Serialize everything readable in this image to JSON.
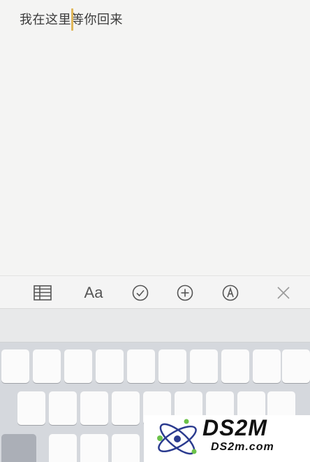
{
  "note": {
    "text": "我在这里等你回来"
  },
  "toolbar": {
    "items": [
      {
        "name": "table",
        "icon": "table-icon"
      },
      {
        "name": "format",
        "icon": "text-format-icon",
        "label": "Aa"
      },
      {
        "name": "checklist",
        "icon": "checklist-icon"
      },
      {
        "name": "add",
        "icon": "plus-circle-icon"
      },
      {
        "name": "markup",
        "icon": "markup-pen-icon"
      },
      {
        "name": "close",
        "icon": "close-icon"
      }
    ]
  },
  "colors": {
    "caret": "#e0b75a",
    "note_background": "#f4f4f3",
    "keyboard_background": "#d5d8dd",
    "key": "#fbfbfb",
    "toolbar_icon": "#555555"
  },
  "watermark": {
    "title": "DS2M",
    "subtitle": "DS2m.com"
  }
}
